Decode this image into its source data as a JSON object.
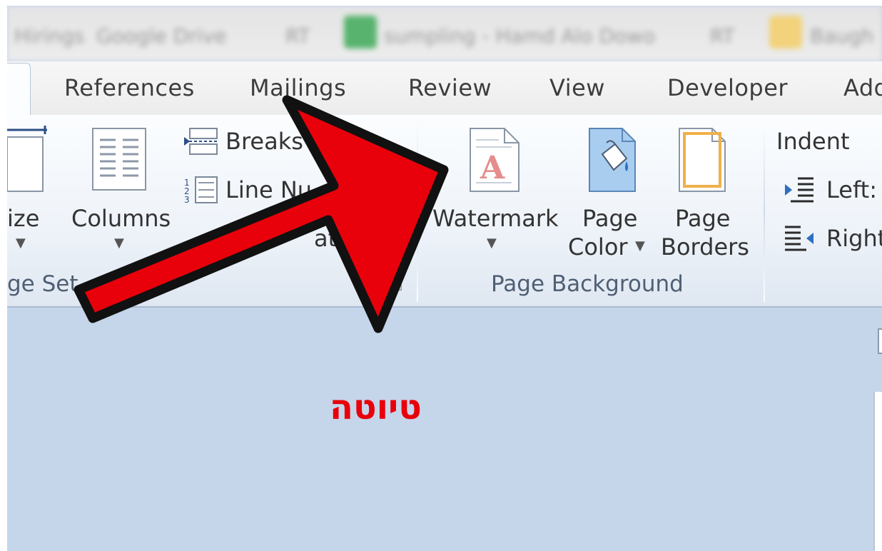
{
  "title_bar": {
    "blurred_items": [
      "Hirings",
      "Google Drive",
      "RT",
      "sumpling - Hamd Alo Dowo",
      "RT",
      "Baugh"
    ]
  },
  "tabs": [
    {
      "label": "References"
    },
    {
      "label": "Mailings"
    },
    {
      "label": "Review"
    },
    {
      "label": "View"
    },
    {
      "label": "Developer"
    },
    {
      "label": "Add"
    }
  ],
  "page_setup": {
    "size_label": "ize",
    "columns_label": "Columns",
    "breaks_label": "Breaks",
    "line_numbers_label": "Line Nu",
    "hyphenation_label": "ation",
    "group_label": "ge Set"
  },
  "page_background": {
    "watermark_label": "Watermark",
    "page_color_label_1": "Page",
    "page_color_label_2": "Color",
    "page_borders_label_1": "Page",
    "page_borders_label_2": "Borders",
    "group_label": "Page Background"
  },
  "paragraph": {
    "indent_label": "Indent",
    "left_label": "Left:",
    "right_label": "Right"
  },
  "annotation": {
    "hebrew_text": "טיוטה",
    "arrow_color": "#e8000a"
  },
  "colors": {
    "ribbon_bg": "#eef3f9",
    "document_area": "#c5d5ea",
    "tab_text": "#3d3d3d"
  }
}
